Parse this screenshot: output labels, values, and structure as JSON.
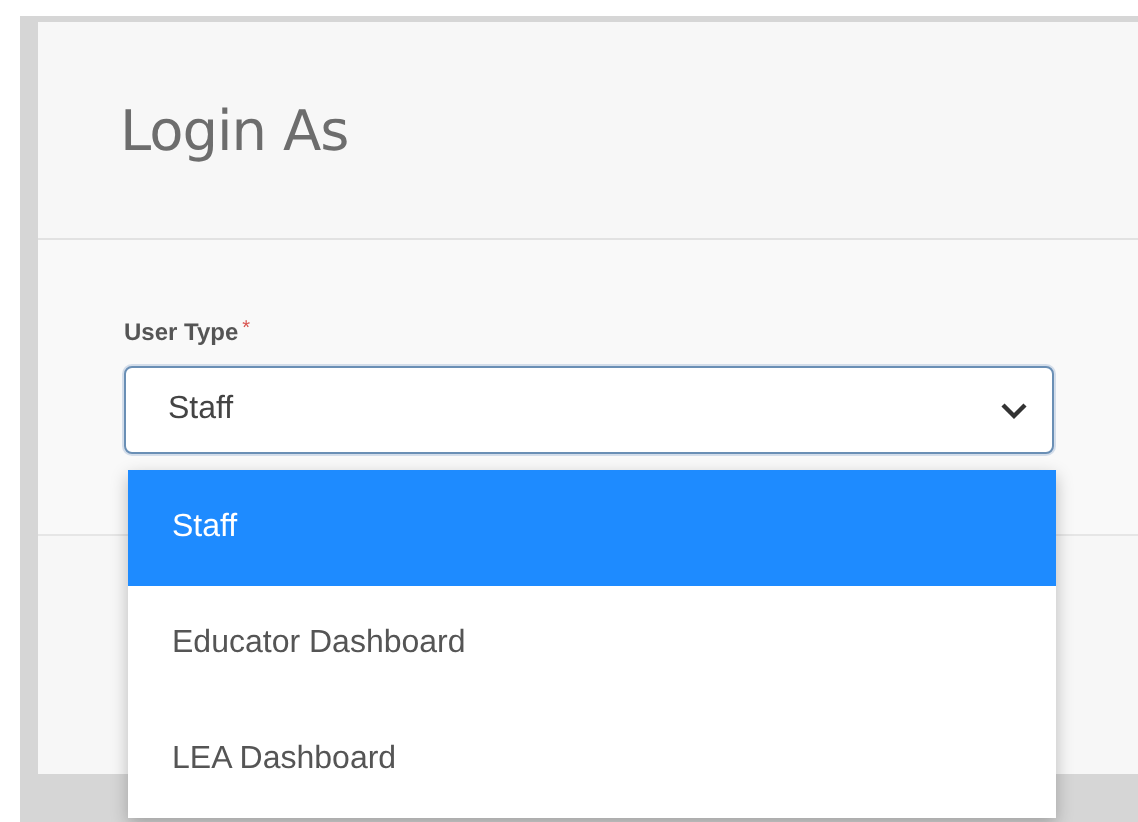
{
  "modal": {
    "title": "Login As"
  },
  "user_type": {
    "label": "User Type",
    "required_mark": "*",
    "value": "Staff",
    "expanded": true,
    "options": [
      {
        "label": "Staff",
        "selected": true
      },
      {
        "label": "Educator Dashboard",
        "selected": false
      },
      {
        "label": "LEA Dashboard",
        "selected": false
      }
    ]
  }
}
